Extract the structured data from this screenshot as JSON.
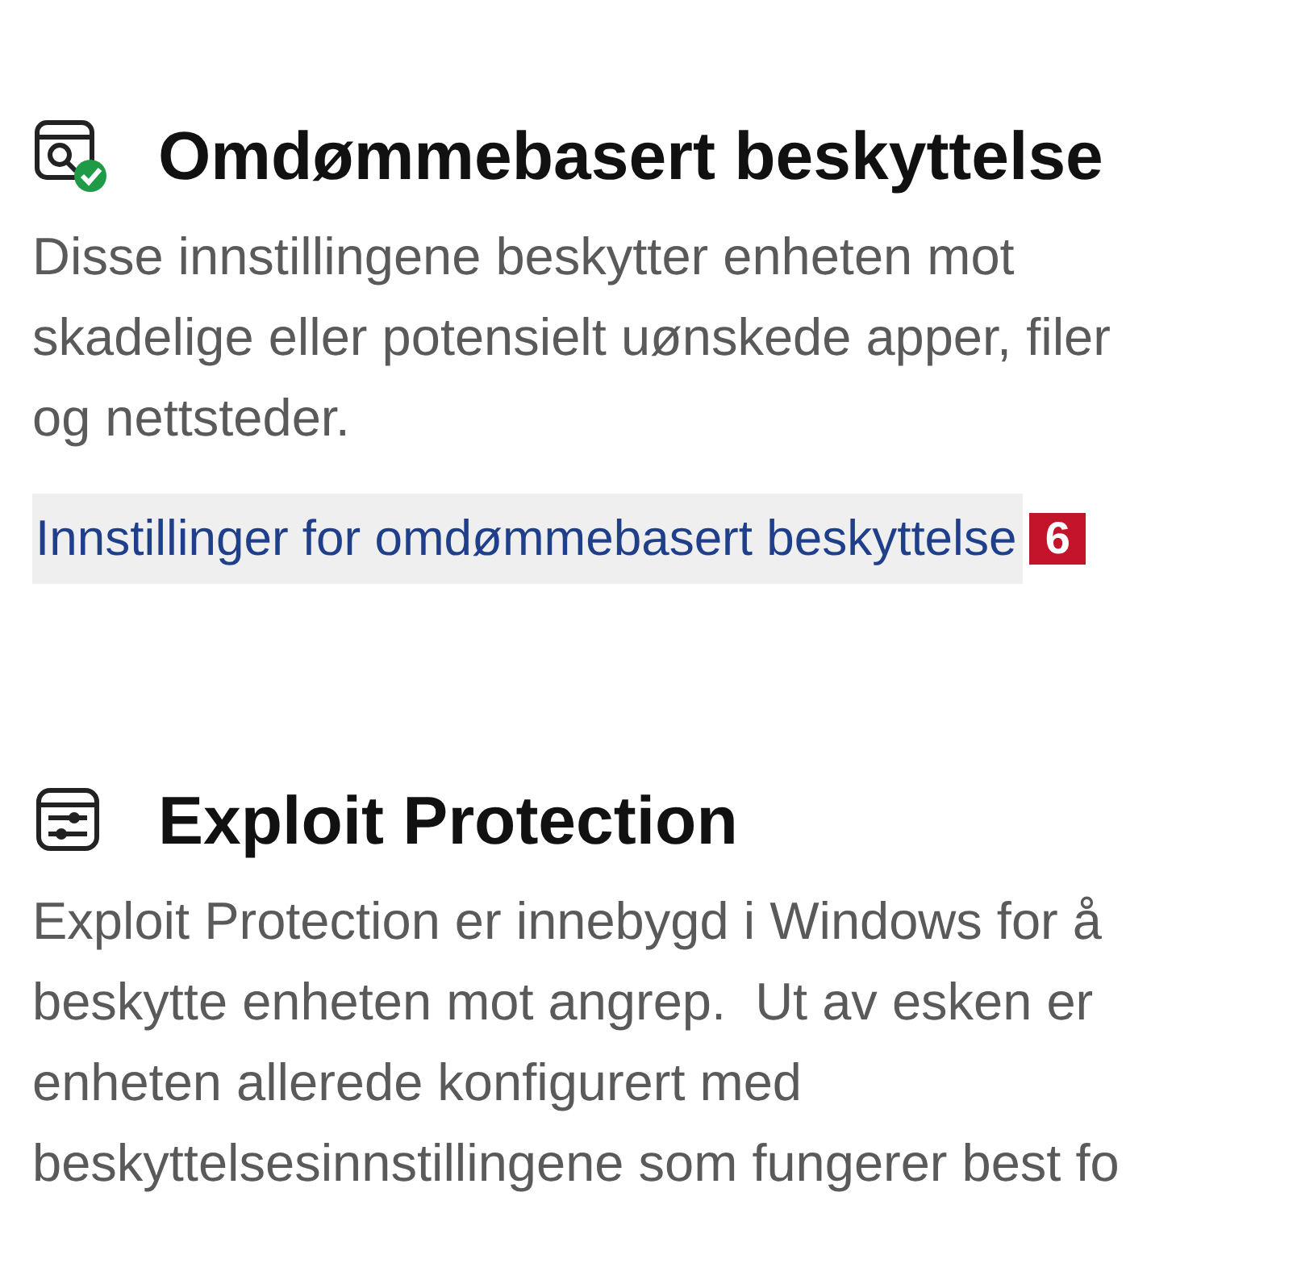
{
  "sections": [
    {
      "kind": "reputation",
      "title": "Omdømmebasert beskyttelse",
      "description": [
        "Disse innstillingene beskytter enheten mot",
        "skadelige eller potensielt uønskede apper, filer",
        "og nettsteder."
      ],
      "link": "Innstillinger for omdømmebasert beskyttelse",
      "badge": "6"
    },
    {
      "kind": "exploit",
      "title": "Exploit Protection",
      "description": [
        "Exploit Protection er innebygd i Windows for å",
        "beskytte enheten mot angrep.  Ut av esken er",
        "enheten allerede konfigurert med",
        "beskyttelsesinnstillingene som fungerer best fo"
      ]
    }
  ]
}
